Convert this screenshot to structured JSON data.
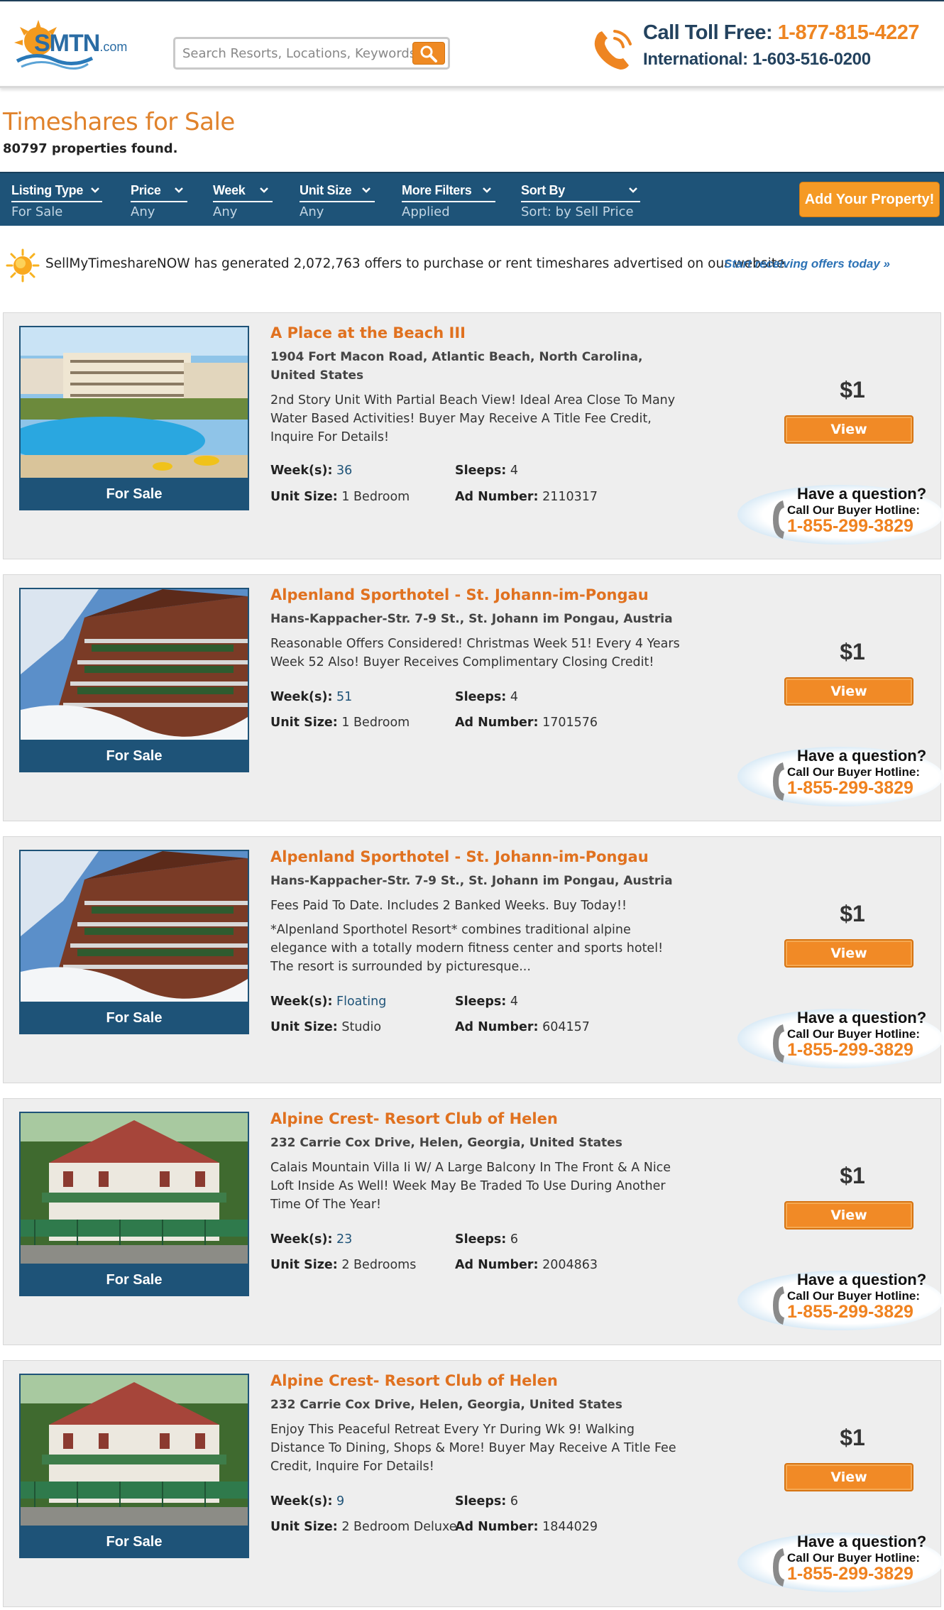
{
  "header": {
    "logo_text": "SMTN",
    "logo_suffix": ".com",
    "search_placeholder": "Search Resorts, Locations, Keywords",
    "call_label": "Call Toll Free:",
    "call_number": "1-877-815-4227",
    "international": "International: 1-603-516-0200"
  },
  "page": {
    "title": "Timeshares for Sale",
    "found": "80797 properties found."
  },
  "filters": [
    {
      "label": "Listing Type",
      "value": "For Sale"
    },
    {
      "label": "Price",
      "value": "Any"
    },
    {
      "label": "Week",
      "value": "Any"
    },
    {
      "label": "Unit Size",
      "value": "Any"
    },
    {
      "label": "More Filters",
      "value": "Applied"
    },
    {
      "label": "Sort By",
      "value": "Sort: by Sell Price"
    }
  ],
  "add_property": "Add Your Property!",
  "offers": {
    "text": "SellMyTimeshareNOW has generated 2,072,763 offers to purchase or rent timeshares advertised on our website.",
    "link": "Start receiving offers today »"
  },
  "labels": {
    "for_sale": "For Sale",
    "weeks": "Week(s):",
    "sleeps": "Sleeps:",
    "unit_size": "Unit Size:",
    "ad_number": "Ad Number:",
    "view": "View",
    "have_question": "Have a question?",
    "hotline_label": "Call Our Buyer Hotline:",
    "hotline_number": "1-855-299-3829"
  },
  "listings": [
    {
      "title": "A Place at the Beach III",
      "address": "1904 Fort Macon Road, Atlantic Beach, North Carolina, United States",
      "description": "2nd Story Unit With Partial Beach View! Ideal Area Close To Many Water Based Activities! Buyer May Receive A Title Fee Credit, Inquire For Details!",
      "description2": "",
      "weeks": "36",
      "sleeps": "4",
      "unit_size": "1 Bedroom",
      "ad_number": "2110317",
      "price": "$1"
    },
    {
      "title": "Alpenland Sporthotel - St. Johann-im-Pongau",
      "address": "Hans-Kappacher-Str. 7-9 St., St. Johann im Pongau, Austria",
      "description": "Reasonable Offers Considered! Christmas Week 51! Every 4 Years Week 52 Also! Buyer Receives Complimentary Closing Credit!",
      "description2": "",
      "weeks": "51",
      "sleeps": "4",
      "unit_size": "1 Bedroom",
      "ad_number": "1701576",
      "price": "$1"
    },
    {
      "title": "Alpenland Sporthotel - St. Johann-im-Pongau",
      "address": "Hans-Kappacher-Str. 7-9 St., St. Johann im Pongau, Austria",
      "description": "Fees Paid To Date. Includes 2 Banked Weeks. Buy Today!!",
      "description2": "*Alpenland Sporthotel Resort* combines traditional alpine elegance with a totally modern fitness center and sports hotel! The resort is surrounded by picturesque...",
      "weeks": "Floating",
      "sleeps": "4",
      "unit_size": "Studio",
      "ad_number": "604157",
      "price": "$1"
    },
    {
      "title": "Alpine Crest- Resort Club of Helen",
      "address": "232 Carrie Cox Drive, Helen, Georgia, United States",
      "description": "Calais Mountain Villa Ii W/ A Large Balcony In The Front & A Nice Loft Inside As Well! Week May Be Traded To Use During Another Time Of The Year!",
      "description2": "",
      "weeks": "23",
      "sleeps": "6",
      "unit_size": "2 Bedrooms",
      "ad_number": "2004863",
      "price": "$1"
    },
    {
      "title": "Alpine Crest- Resort Club of Helen",
      "address": "232 Carrie Cox Drive, Helen, Georgia, United States",
      "description": "Enjoy This Peaceful Retreat Every Yr During Wk 9! Walking Distance To Dining, Shops & More! Buyer May Receive A Title Fee Credit, Inquire For Details!",
      "description2": "",
      "weeks": "9",
      "sleeps": "6",
      "unit_size": "2 Bedroom Deluxe",
      "ad_number": "1844029",
      "price": "$1"
    }
  ],
  "colors": {
    "brand_navy": "#1e5378",
    "accent_orange": "#f18a26",
    "title_orange": "#e0711f"
  }
}
